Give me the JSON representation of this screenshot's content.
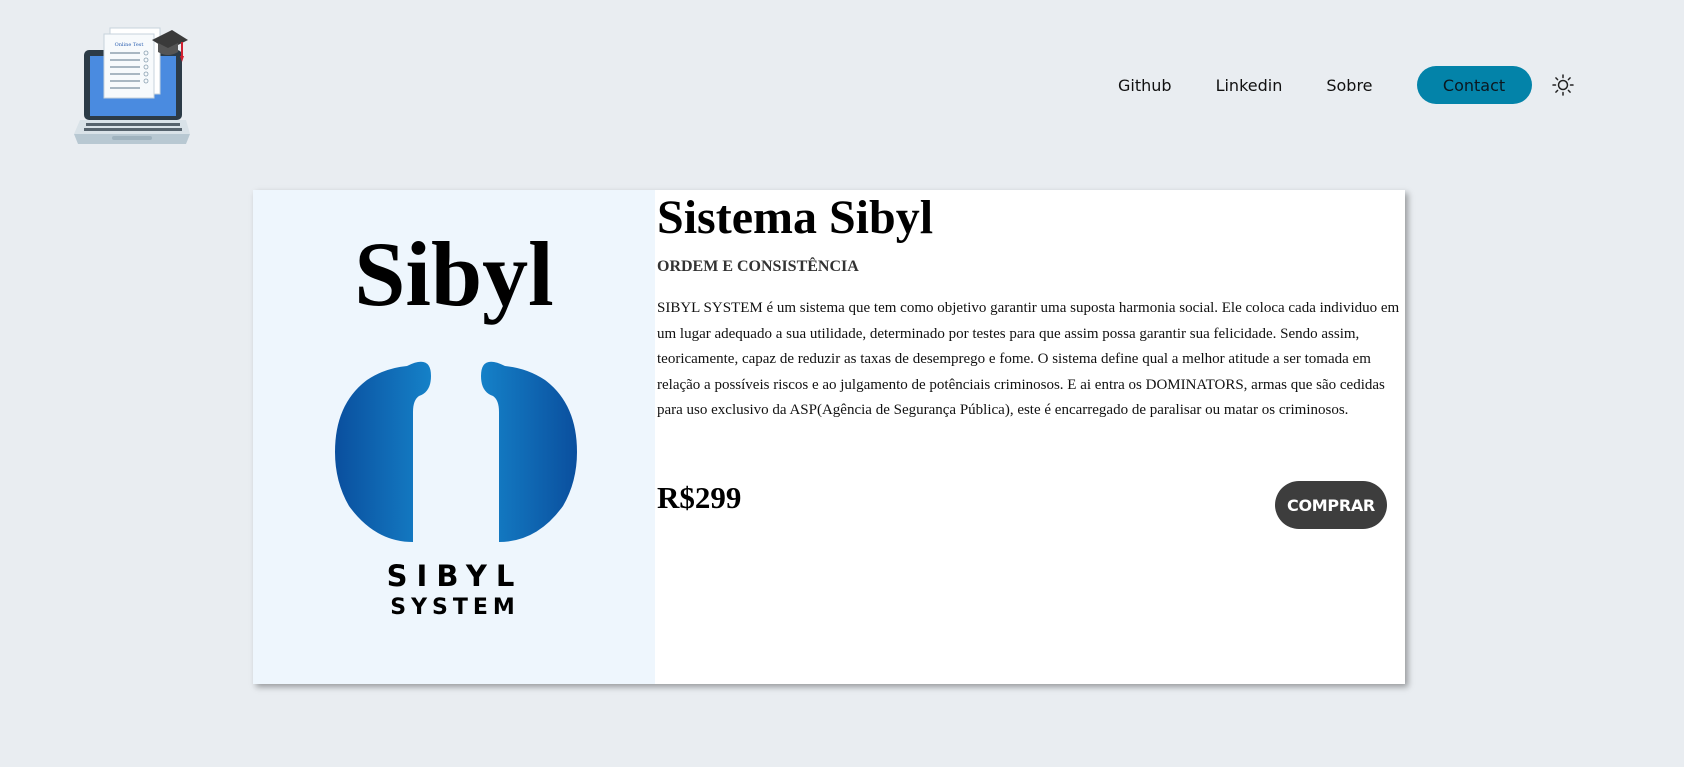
{
  "header": {
    "logo_icon": "laptop-online-test-icon",
    "logo_text": "Online Test",
    "nav": {
      "github": "Github",
      "linkedin": "Linkedin",
      "sobre": "Sobre",
      "contact": "Contact"
    },
    "theme_icon": "sun-icon"
  },
  "product": {
    "image": {
      "word": "Sibyl",
      "caption_line1": "SIBYL",
      "caption_line2": "SYSTEM"
    },
    "title": "Sistema Sibyl",
    "subtitle": "ORDEM E CONSISTÊNCIA",
    "description": "SIBYL SYSTEM é um sistema que tem como objetivo garantir uma suposta harmonia social. Ele coloca cada individuo em um lugar adequado a sua utilidade, determinado por testes para que assim possa garantir sua felicidade. Sendo assim, teoricamente, capaz de reduzir as taxas de desemprego e fome. O sistema define qual a melhor atitude a ser tomada em relação a possíveis riscos e ao julgamento de potênciais criminosos. E ai entra os DOMINATORS, armas que são cedidas para uso exclusivo da ASP(Agência de Segurança Pública), este é encarregado de paralisar ou matar os criminosos.",
    "price": "R$299",
    "buy_label": "COMPRAR"
  },
  "colors": {
    "page_background": "#e9edf1",
    "accent": "#0383a9",
    "buy_button": "#3d3d3d",
    "image_panel": "#eef6fd",
    "emblem_blue": "#0d6fb8"
  }
}
